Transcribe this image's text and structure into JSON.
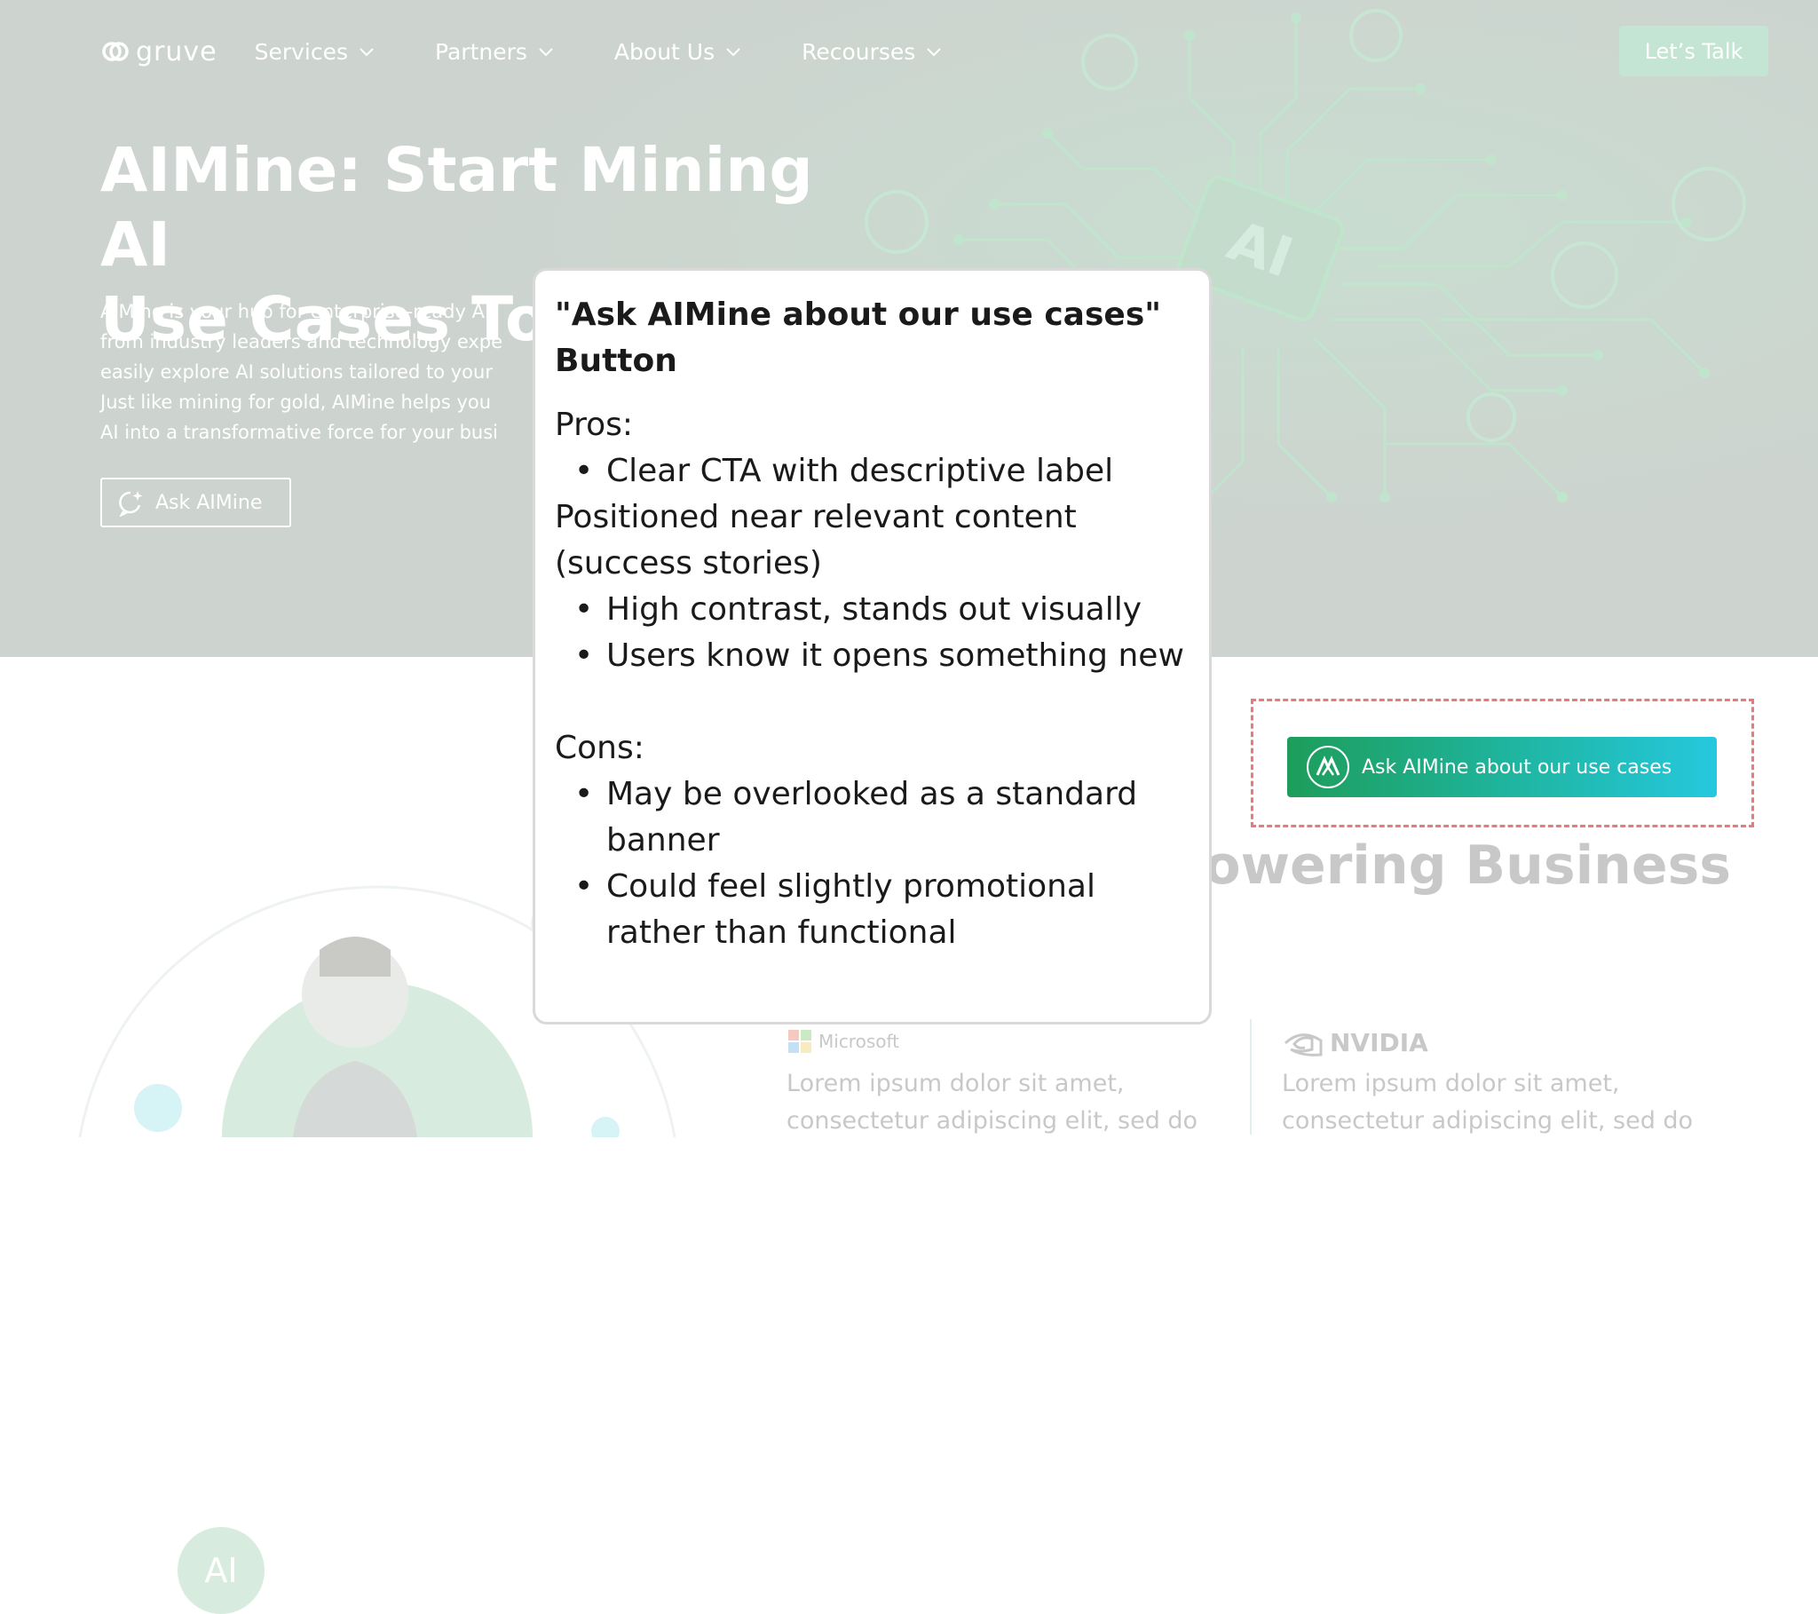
{
  "nav": {
    "logo_text": "gruve",
    "items": [
      {
        "label": "Services"
      },
      {
        "label": "Partners"
      },
      {
        "label": "About Us"
      },
      {
        "label": "Recourses"
      }
    ],
    "cta_label": "Let’s Talk"
  },
  "hero": {
    "title_line1": "AIMine: Start Mining AI",
    "title_line2": "Use Cases Today",
    "desc_lines": [
      "AIMine is your hub for enterprise-ready AI",
      "from industry leaders and technology expe",
      "easily explore AI solutions tailored to your",
      "Just like mining for gold, AIMine helps you",
      "AI into a transformative force for your busi"
    ],
    "ask_button_label": "Ask AIMine",
    "art_label": "AI"
  },
  "lower": {
    "usecase_button_label": "Ask AIMine about our use cases",
    "section_heading_partial": "owering Business",
    "ai_badge": "AI",
    "partners": [
      {
        "name": "Microsoft",
        "text_line1": "Lorem ipsum dolor sit amet,",
        "text_line2": "consectetur adipiscing elit, sed do"
      },
      {
        "name": "NVIDIA",
        "text_line1": "Lorem ipsum dolor sit amet,",
        "text_line2": "consectetur adipiscing elit, sed do"
      }
    ]
  },
  "popup": {
    "title_line1": "\"Ask AIMine about our use cases\"",
    "title_line2": "Button",
    "pros_heading": "Pros:",
    "pros": [
      "Clear CTA with descriptive label",
      "Positioned near relevant content",
      "(success stories)",
      "High contrast, stands out visually",
      "Users know it opens something new"
    ],
    "cons_heading": "Cons:",
    "cons": [
      "May be overlooked as a standard banner",
      "Could feel slightly promotional rather than functional"
    ]
  },
  "colors": {
    "hero_overlay": "#cdd3cf",
    "circuit_green": "#b9e6c9",
    "cta_gradient_start": "#1d9d5a",
    "cta_gradient_end": "#25c8de",
    "dashed_highlight": "#e87a7a",
    "muted_text": "#c8c8c8"
  }
}
